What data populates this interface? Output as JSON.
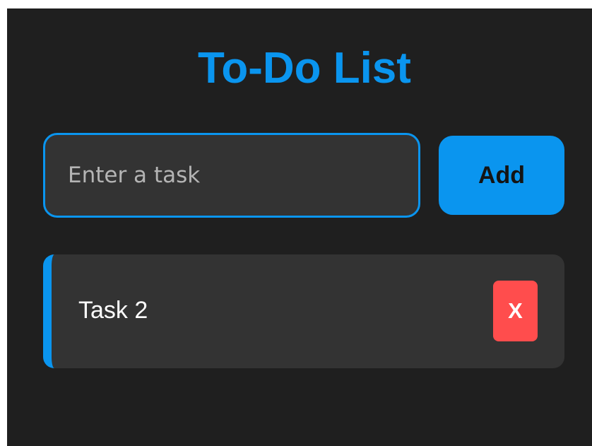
{
  "app": {
    "title": "To-Do List"
  },
  "input": {
    "placeholder": "Enter a task",
    "value": ""
  },
  "add_button": {
    "label": "Add"
  },
  "tasks": [
    {
      "label": "Task 2",
      "delete_label": "X"
    }
  ],
  "colors": {
    "accent": "#0a95ef",
    "background": "#1f1f1f",
    "surface": "#333333",
    "danger": "#ff4d4d"
  }
}
